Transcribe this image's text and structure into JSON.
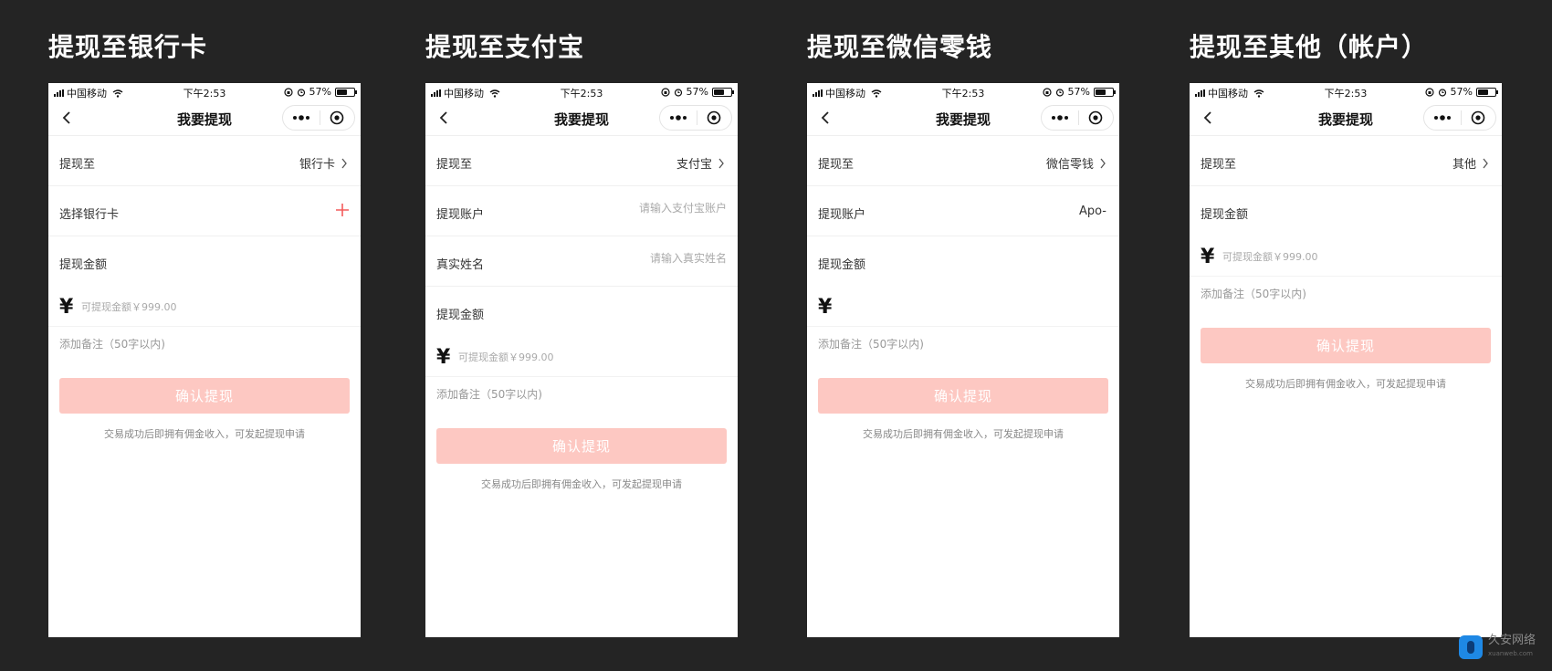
{
  "status": {
    "carrier": "中国移动",
    "time": "下午2:53",
    "battery": "57%",
    "battery_level": 0.57
  },
  "nav": {
    "title": "我要提现"
  },
  "common": {
    "row_to": "提现至",
    "row_amount": "提现金额",
    "currency": "¥",
    "amount_placeholder": "可提现金额￥999.00",
    "note_placeholder": "添加备注（50字以内)",
    "confirm": "确认提现",
    "tip": "交易成功后即拥有佣金收入，可发起提现申请"
  },
  "screens": [
    {
      "title": "提现至银行卡",
      "method": "银行卡",
      "select_label": "选择银行卡"
    },
    {
      "title": "提现至支付宝",
      "method": "支付宝",
      "account_label": "提现账户",
      "account_placeholder": "请输入支付宝账户",
      "name_label": "真实姓名",
      "name_placeholder": "请输入真实姓名"
    },
    {
      "title": "提现至微信零钱",
      "method": "微信零钱",
      "account_label": "提现账户",
      "account_value": "Apo-"
    },
    {
      "title": "提现至其他（帐户）",
      "method": "其他"
    }
  ],
  "watermark": {
    "name": "久安网络",
    "sub": "xuanweb.com"
  },
  "colors": {
    "background": "#242424",
    "button": "#fdc8c2",
    "accent": "#f45b5b"
  }
}
